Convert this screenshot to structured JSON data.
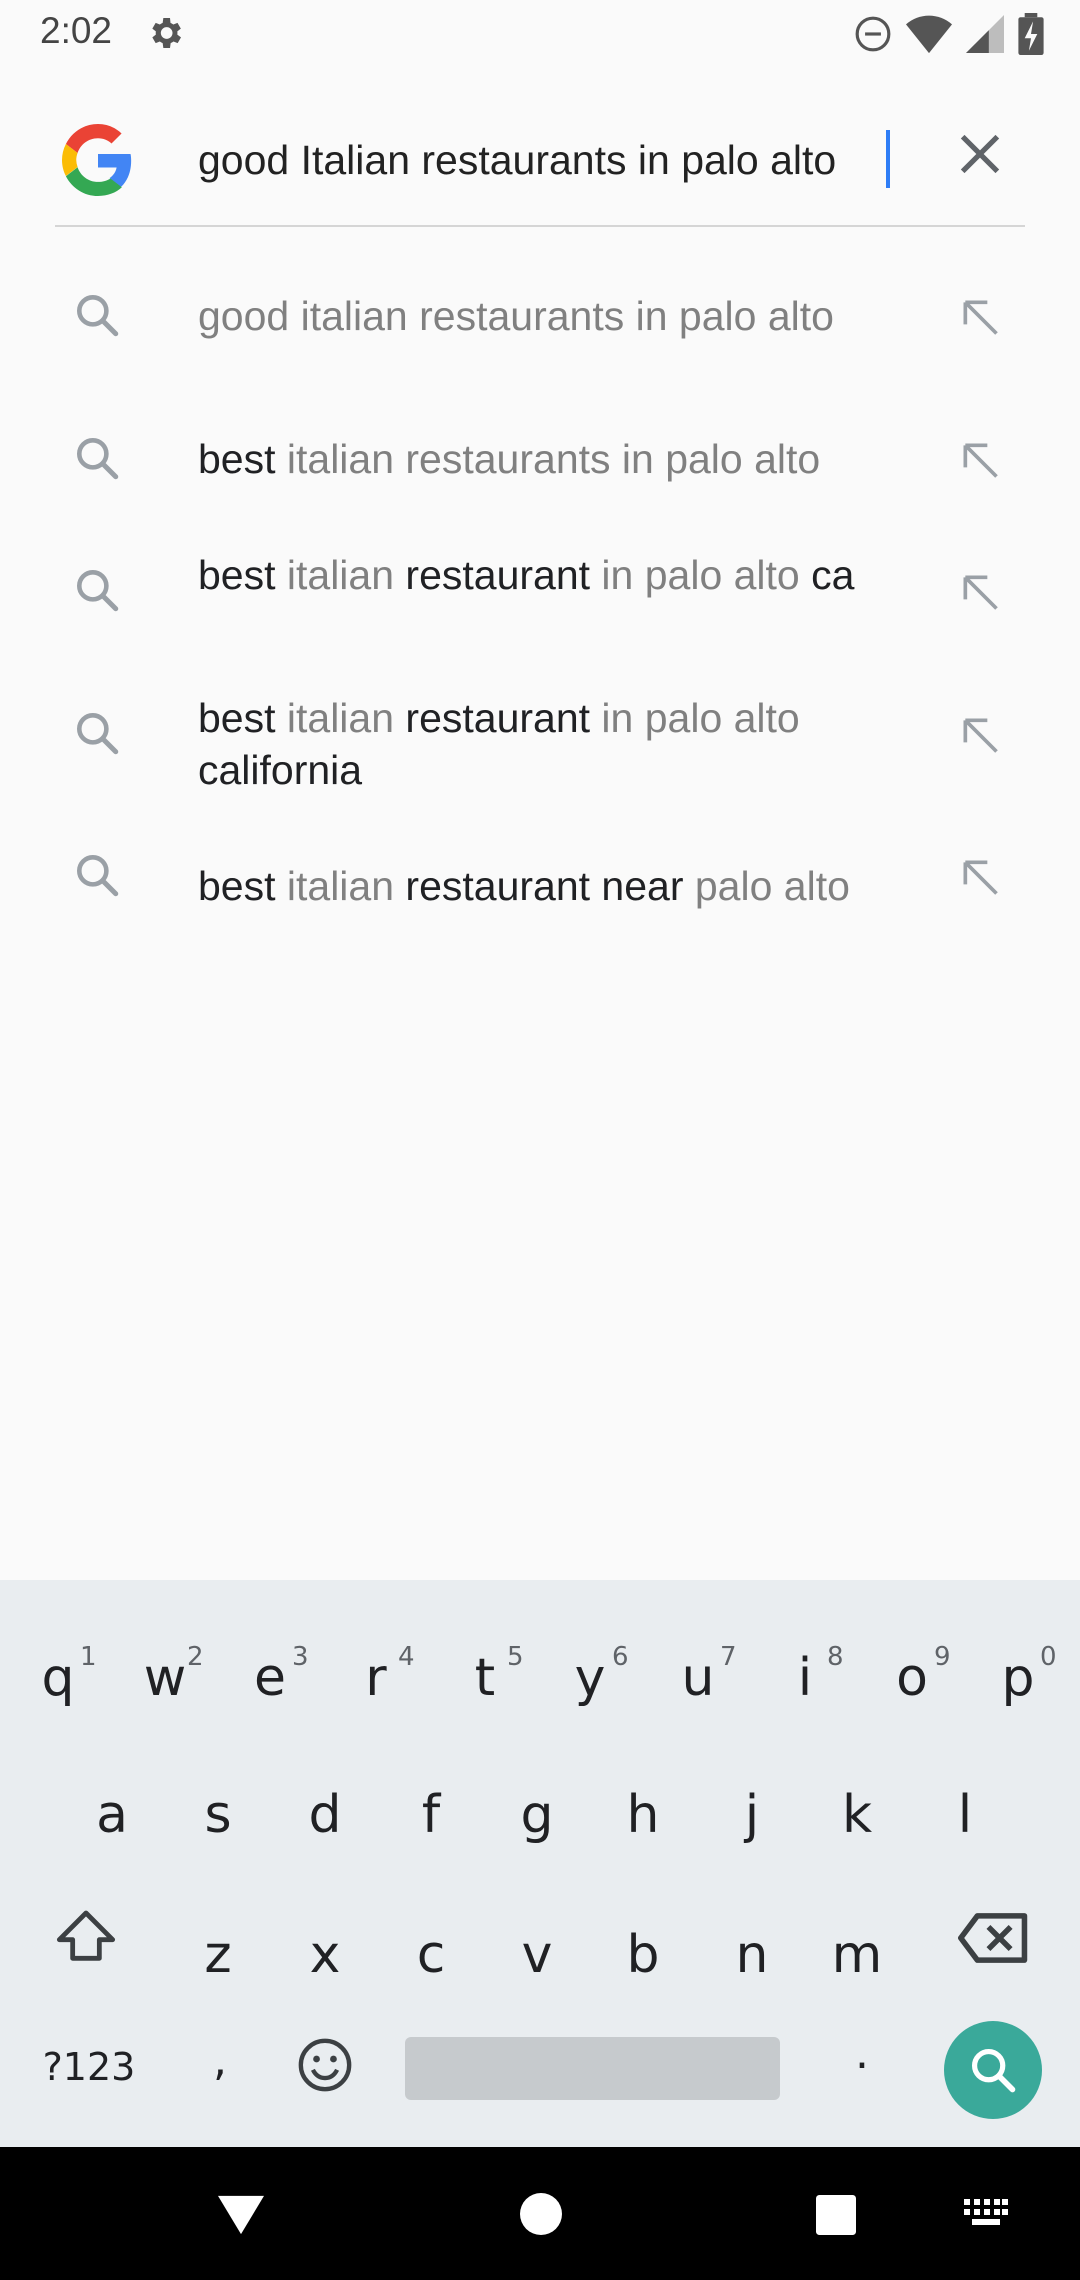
{
  "status_bar": {
    "time": "2:02",
    "icons": [
      "settings-icon",
      "do-not-disturb-icon",
      "wifi-icon",
      "signal-icon",
      "battery-charging-icon"
    ]
  },
  "search": {
    "query": "good Italian restaurants in palo alto",
    "clear_icon": "close-icon",
    "logo": "google-g-logo"
  },
  "suggestions": [
    {
      "parts": [
        {
          "text": "good italian restaurants in palo alto",
          "bold": false
        }
      ]
    },
    {
      "parts": [
        {
          "text": "best",
          "bold": true
        },
        {
          "text": " italian restaurants in palo alto",
          "bold": false
        }
      ]
    },
    {
      "parts": [
        {
          "text": "best",
          "bold": true
        },
        {
          "text": " italian ",
          "bold": false
        },
        {
          "text": "restaurant",
          "bold": true
        },
        {
          "text": " in palo alto",
          "bold": false
        },
        {
          "text": " ca",
          "bold": true
        }
      ]
    },
    {
      "parts": [
        {
          "text": "best",
          "bold": true
        },
        {
          "text": " italian ",
          "bold": false
        },
        {
          "text": "restaurant",
          "bold": true
        },
        {
          "text": " in palo alto",
          "bold": false
        },
        {
          "text": " california",
          "bold": true
        }
      ]
    },
    {
      "parts": [
        {
          "text": "best",
          "bold": true
        },
        {
          "text": " italian ",
          "bold": false
        },
        {
          "text": "restaurant near",
          "bold": true
        },
        {
          "text": " palo alto",
          "bold": false
        }
      ]
    }
  ],
  "keyboard": {
    "row1": [
      {
        "k": "q",
        "n": "1"
      },
      {
        "k": "w",
        "n": "2"
      },
      {
        "k": "e",
        "n": "3"
      },
      {
        "k": "r",
        "n": "4"
      },
      {
        "k": "t",
        "n": "5"
      },
      {
        "k": "y",
        "n": "6"
      },
      {
        "k": "u",
        "n": "7"
      },
      {
        "k": "i",
        "n": "8"
      },
      {
        "k": "o",
        "n": "9"
      },
      {
        "k": "p",
        "n": "0"
      }
    ],
    "row2": [
      "a",
      "s",
      "d",
      "f",
      "g",
      "h",
      "j",
      "k",
      "l"
    ],
    "row3": [
      "z",
      "x",
      "c",
      "v",
      "b",
      "n",
      "m"
    ],
    "symbols_key": "?123",
    "comma_key": ",",
    "period_key": ".",
    "colors": {
      "search_key": "#3aa99a",
      "background": "#e9edf0"
    }
  },
  "nav_bar": {
    "icons": [
      "back-icon",
      "home-icon",
      "recents-icon",
      "keyboard-switch-icon"
    ]
  }
}
